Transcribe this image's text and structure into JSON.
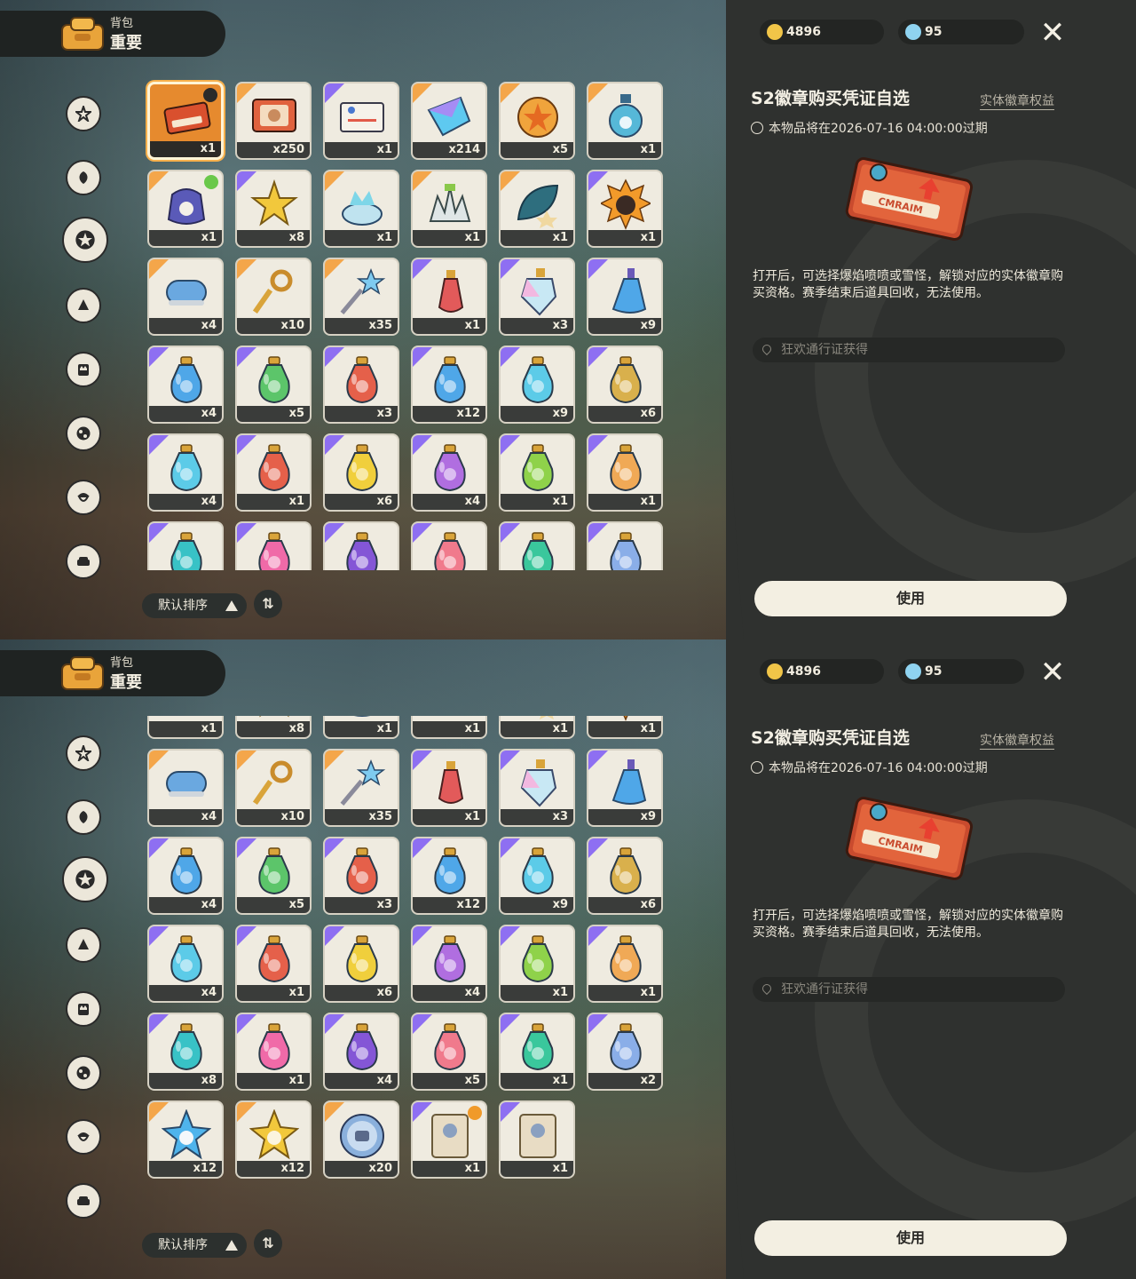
{
  "header": {
    "title_small": "背包",
    "title_large": "重要"
  },
  "currency": {
    "coins": "4896",
    "gems": "95"
  },
  "detail": {
    "title": "S2徽章购买凭证自选",
    "tag": "实体徽章权益",
    "expire_text": "本物品将在2026-07-16 04:00:00过期",
    "description": "打开后，可选择爆焰喷喷或雪怪，解锁对应的实体徽章购买资格。赛季结束后道具回收，无法使用。",
    "source": "狂欢通行证获得",
    "use_label": "使用"
  },
  "sort": {
    "label": "默认排序"
  },
  "colors": {
    "accent_purple": "#8e6ff2",
    "accent_orange": "#f4a64a",
    "selected": "#e68a2e"
  },
  "screen1": {
    "counts": [
      "x1",
      "x250",
      "x1",
      "x214",
      "x5",
      "x1",
      "x1",
      "x8",
      "x1",
      "x1",
      "x1",
      "x1",
      "x4",
      "x10",
      "x35",
      "x1",
      "x3",
      "x9",
      "x4",
      "x5",
      "x3",
      "x12",
      "x9",
      "x6",
      "x4",
      "x1",
      "x6",
      "x4",
      "x1",
      "x1",
      "",
      "",
      "",
      "",
      "",
      ""
    ]
  },
  "screen2": {
    "counts": [
      "x1",
      "x8",
      "x1",
      "x1",
      "x1",
      "x1",
      "x4",
      "x10",
      "x35",
      "x1",
      "x3",
      "x9",
      "x4",
      "x5",
      "x3",
      "x12",
      "x9",
      "x6",
      "x4",
      "x1",
      "x6",
      "x4",
      "x1",
      "x1",
      "x8",
      "x1",
      "x4",
      "x5",
      "x1",
      "x2",
      "x12",
      "x12",
      "x20",
      "x1",
      "x1"
    ]
  }
}
